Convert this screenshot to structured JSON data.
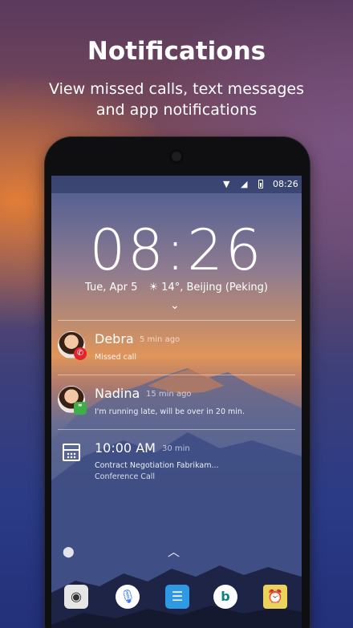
{
  "promo": {
    "title": "Notifications",
    "subtitle_line1": "View missed calls, text messages",
    "subtitle_line2": "and app notifications"
  },
  "status_bar": {
    "time": "08:26",
    "icons": [
      "wifi-icon",
      "signal-icon",
      "battery-icon"
    ]
  },
  "lockscreen": {
    "clock": "08:26",
    "date": "Tue, Apr 5",
    "weather": "14°, Beijing (Peking)"
  },
  "notifications": [
    {
      "name": "Debra",
      "time": "5 min ago",
      "text": "Missed call",
      "badge": "missed-call-icon"
    },
    {
      "name": "Nadina",
      "time": "15 min ago",
      "text": "I'm running late, will be over in 20 min.",
      "badge": "hangouts-icon"
    },
    {
      "name": "10:00 AM",
      "time": "30 min",
      "text": "Contract Negotiation Fabrikam...",
      "text2": "Conference Call",
      "badge": "calendar-icon"
    }
  ],
  "dock": [
    "camera-icon",
    "mic-icon",
    "messages-icon",
    "bing-icon",
    "alarm-clock-icon"
  ],
  "colors": {
    "missed_call_badge": "#e2242d",
    "hangouts_badge": "#3fae49",
    "bing": "#0f7e8a"
  }
}
